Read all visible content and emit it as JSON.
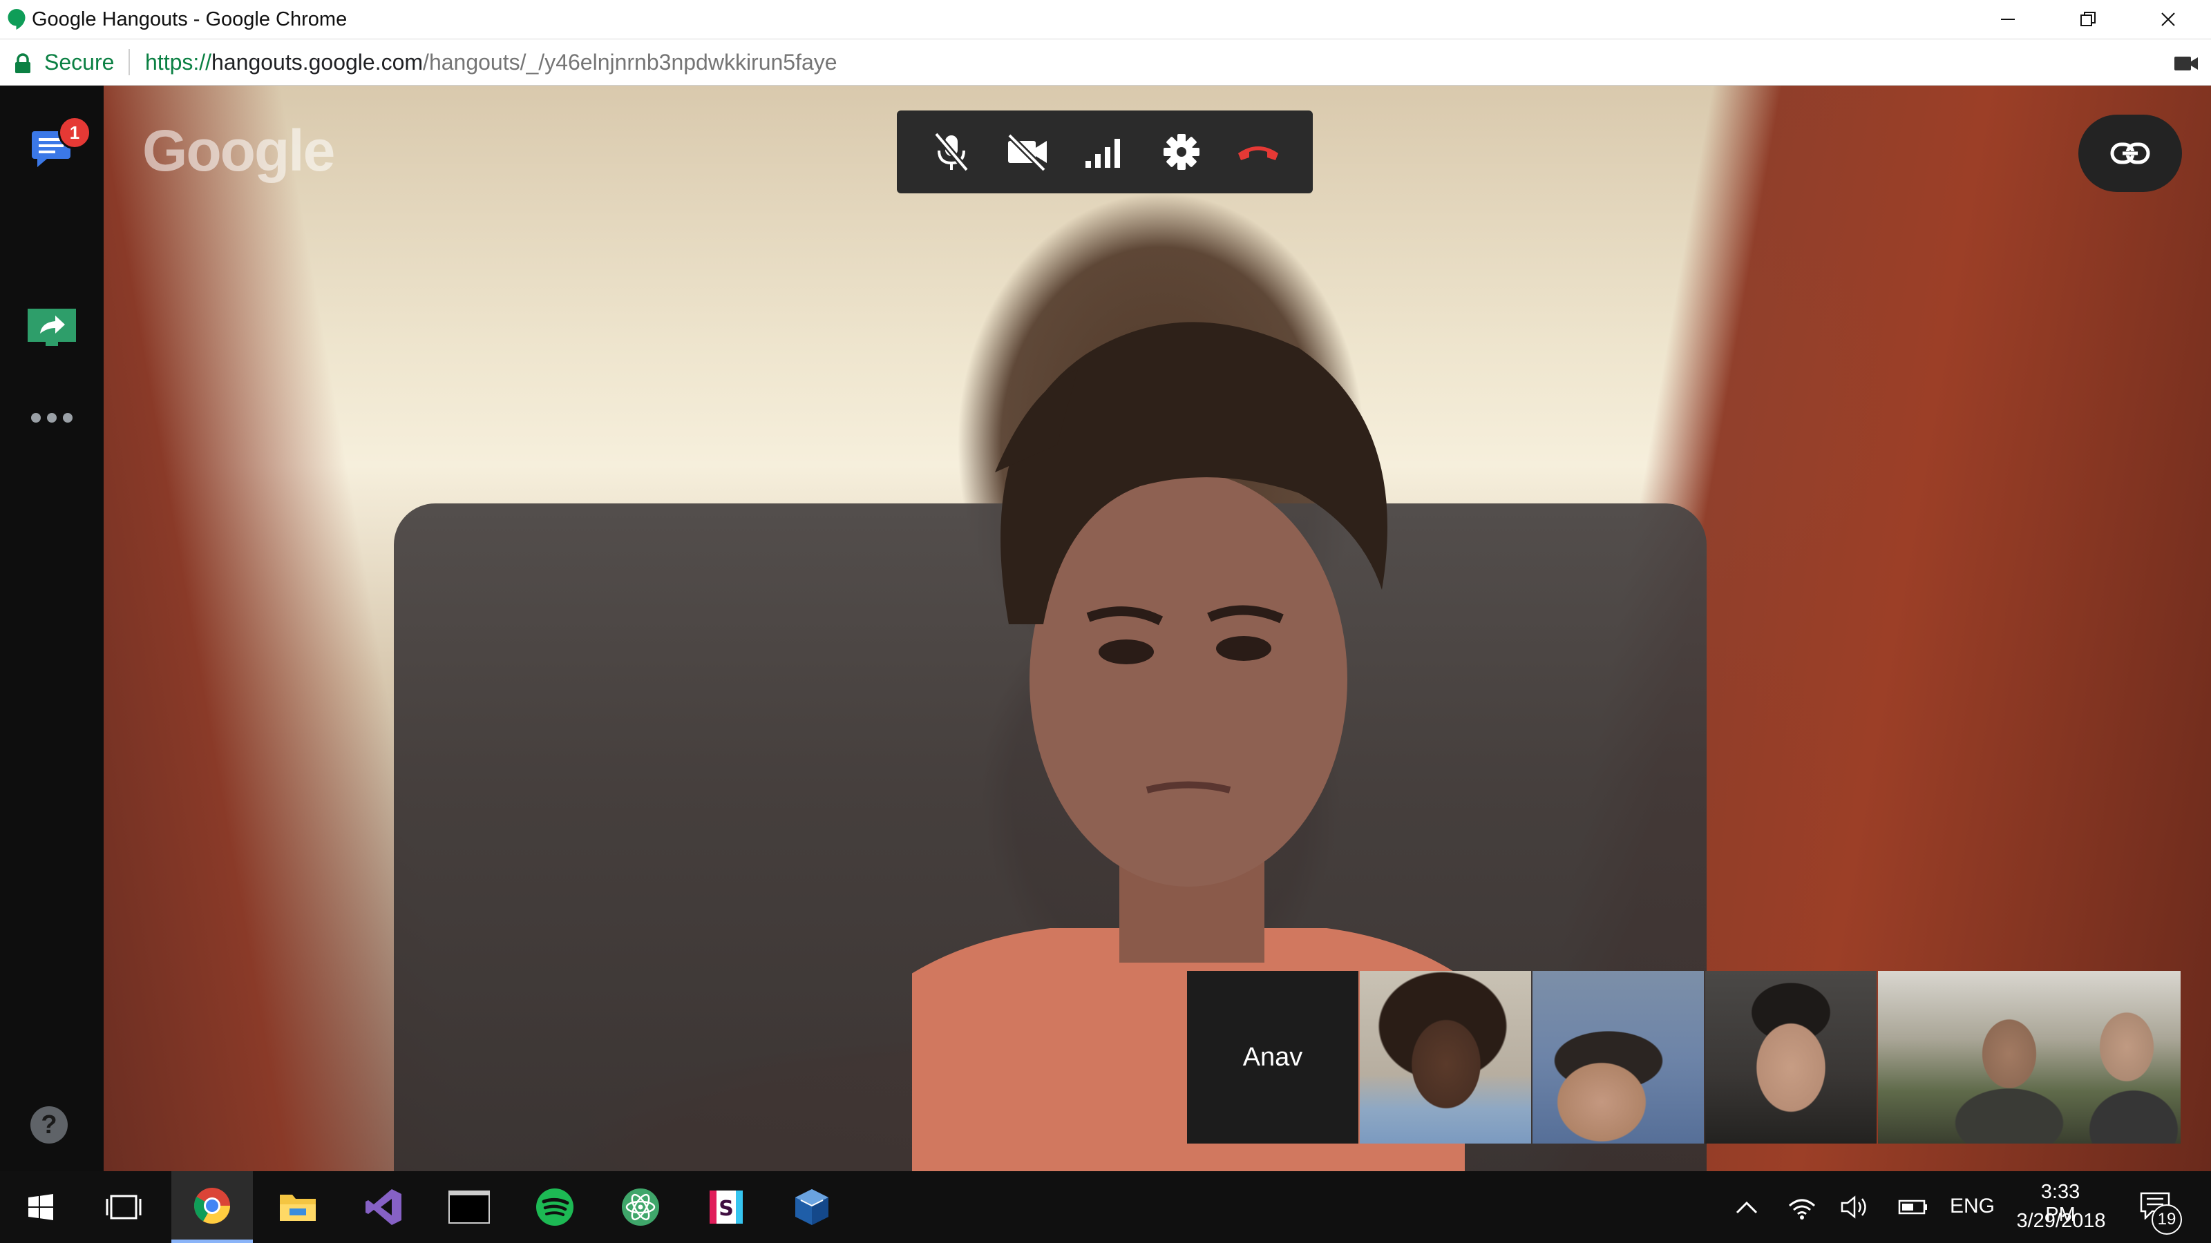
{
  "window": {
    "title": "Google Hangouts - Google Chrome"
  },
  "addressbar": {
    "secure_label": "Secure",
    "url_scheme": "https://",
    "url_host": "hangouts.google.com",
    "url_path": "/hangouts/_/y46elnjnrnb3npdwkkirun5faye"
  },
  "watermark": "Google",
  "leftrail": {
    "chat_badge": "1",
    "help_label": "?"
  },
  "calltoolbar": {
    "buttons": [
      "mic-off",
      "camera-off",
      "signal-strength",
      "settings",
      "end-call"
    ]
  },
  "filmstrip": {
    "participants": [
      {
        "name": "Anav",
        "video": false
      },
      {
        "name": "",
        "video": true
      },
      {
        "name": "",
        "video": true
      },
      {
        "name": "",
        "video": true
      },
      {
        "name": "",
        "video": true
      }
    ]
  },
  "taskbar": {
    "language": "ENG",
    "time": "3:33 PM",
    "date": "3/29/2018",
    "notifications": "19"
  },
  "colors": {
    "secure_green": "#0b8043",
    "end_call_red": "#e53935",
    "badge_red": "#e53935",
    "hangouts_blue": "#3b78e7",
    "share_green": "#2e9e6a"
  }
}
